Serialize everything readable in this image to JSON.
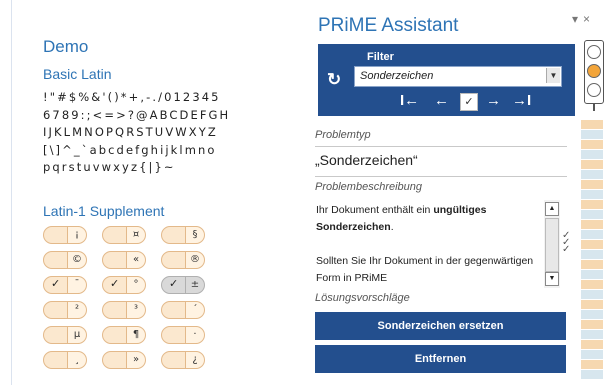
{
  "document": {
    "title": "Demo",
    "basic_latin": {
      "heading": "Basic Latin",
      "lines": [
        "!\"#$%&'()*+,-./012345",
        "6789:;<=>?@ABCDEFGH",
        "IJKLMNOPQRSTUVWXYZ",
        "[\\]^_`abcdefghijklmno",
        "pqrstuvwxyz{|}~"
      ]
    },
    "latin1": {
      "heading": "Latin-1 Supplement",
      "rows": [
        [
          {
            "char": "¡",
            "mark": ""
          },
          {
            "char": "¤",
            "mark": ""
          },
          {
            "char": "§",
            "mark": ""
          }
        ],
        [
          {
            "char": "©",
            "mark": ""
          },
          {
            "char": "«",
            "mark": ""
          },
          {
            "char": "®",
            "mark": ""
          }
        ],
        [
          {
            "char": "¯",
            "mark": "✓"
          },
          {
            "char": "°",
            "mark": "✓"
          },
          {
            "char": "±",
            "mark": "✓",
            "selected": true
          }
        ],
        [
          {
            "char": "²",
            "mark": ""
          },
          {
            "char": "³",
            "mark": ""
          },
          {
            "char": "´",
            "mark": ""
          }
        ],
        [
          {
            "char": "µ",
            "mark": ""
          },
          {
            "char": "¶",
            "mark": ""
          },
          {
            "char": "·",
            "mark": ""
          }
        ],
        [
          {
            "char": "¸",
            "mark": ""
          },
          {
            "char": "»",
            "mark": ""
          },
          {
            "char": "¿",
            "mark": ""
          }
        ]
      ]
    }
  },
  "pane": {
    "title": "PRiME Assistant",
    "controls": {
      "menu": "▾",
      "close": "×"
    },
    "filter": {
      "label": "Filter",
      "value": "Sonderzeichen",
      "refresh_icon": "refresh-icon"
    },
    "nav": {
      "first": "I←",
      "prev": "←",
      "check": "✓",
      "next": "→",
      "last": "→I"
    },
    "traffic_light": {
      "red": "#ffffff",
      "yellow": "#f3a53a",
      "green": "#ffffff"
    },
    "problem_type_label": "Problemtyp",
    "problem_type_value": "„Sonderzeichen“",
    "description_label": "Problembeschreibung",
    "description": {
      "p1_a": "Ihr Dokument enthält ein ",
      "p1_b": "ungültiges Sonderzeichen",
      "p1_c": ".",
      "p2": "Sollten Sie Ihr Dokument in der gegenwärtigen Form in PRiME"
    },
    "solutions_label": "Lösungsvorschläge",
    "buttons": {
      "replace": "Sonderzeichen ersetzen",
      "remove": "Entfernen"
    }
  },
  "colors": {
    "accent": "#234f8e",
    "heading": "#2e74b5",
    "stripe_a": "#f6d8b0",
    "stripe_b": "#d7e6ee"
  }
}
